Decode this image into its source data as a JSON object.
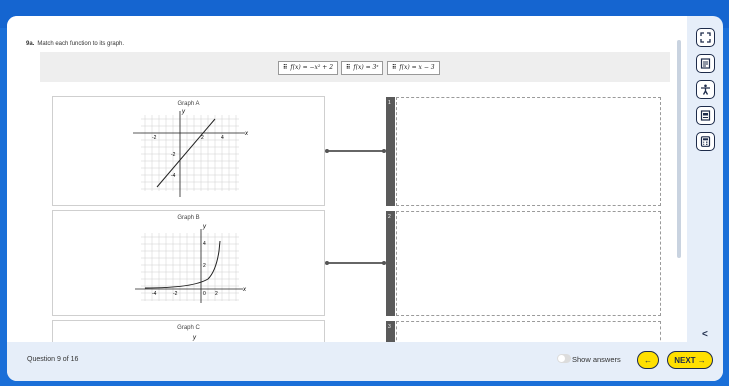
{
  "question": {
    "number": "9a.",
    "prompt": "Match each function to its graph."
  },
  "choices": [
    {
      "grip": "⠿",
      "label": "f(x) = −x² + 2"
    },
    {
      "grip": "⠿",
      "label": "f(x) = 3ˣ"
    },
    {
      "grip": "⠿",
      "label": "f(x) = x − 3"
    }
  ],
  "graphs": [
    {
      "title": "Graph A",
      "x_axis": "x",
      "y_axis": "y",
      "ticks": [
        "-2",
        "2",
        "4",
        "-2",
        "-4"
      ]
    },
    {
      "title": "Graph B",
      "x_axis": "x",
      "y_axis": "y",
      "ticks": [
        "-4",
        "-2",
        "0",
        "2",
        "4",
        "2"
      ]
    },
    {
      "title": "Graph C",
      "y_axis": "y"
    }
  ],
  "drop_zones": [
    {
      "number": "1"
    },
    {
      "number": "2"
    },
    {
      "number": "3"
    }
  ],
  "tools": [
    {
      "icon": "fullscreen-icon"
    },
    {
      "icon": "notes-icon"
    },
    {
      "icon": "accessibility-icon"
    },
    {
      "icon": "reference-sheet-icon"
    },
    {
      "icon": "calculator-icon"
    }
  ],
  "footer": {
    "question_count": "Question 9 of 16",
    "show_answers": "Show answers",
    "back_label": "←",
    "next_label": "NEXT →"
  },
  "collapse_label": "<"
}
